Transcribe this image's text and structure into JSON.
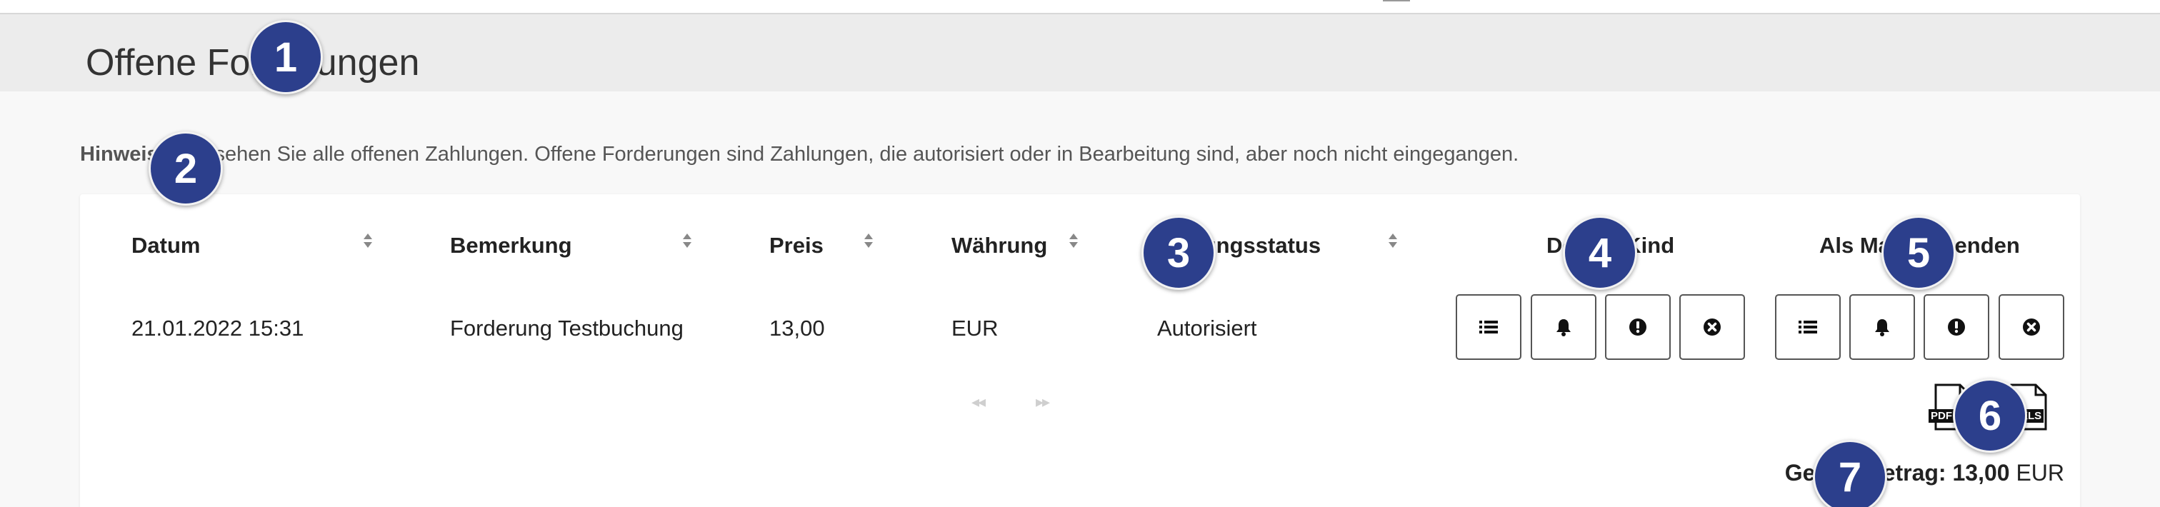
{
  "header": {
    "title": "Offene Forderungen"
  },
  "notice": {
    "label": "Hinweis:",
    "text": "Hier sehen Sie alle offenen Zahlungen. Offene Forderungen sind Zahlungen, die autorisiert oder in Bearbeitung sind, aber noch nicht eingegangen."
  },
  "table": {
    "columns": {
      "datum": "Datum",
      "bemerkung": "Bemerkung",
      "preis": "Preis",
      "waehrung": "Währung",
      "status": "Zahlungsstatus",
      "details": "Details Kind",
      "mail": "Als Mail versenden"
    },
    "rows": [
      {
        "datum": "21.01.2022 15:31",
        "bemerkung": "Forderung Testbuchung",
        "preis": "13,00",
        "waehrung": "EUR",
        "status": "Autorisiert"
      }
    ]
  },
  "pager": {
    "prev": "◂◂",
    "next": "▸▸"
  },
  "exports": {
    "pdf": "PDF",
    "xls": "XLS"
  },
  "total": {
    "label": "Gesamtbetrag:",
    "amount": "13,00",
    "currency": "EUR"
  },
  "markers": [
    "1",
    "2",
    "3",
    "4",
    "5",
    "6",
    "7"
  ],
  "icons": [
    "list-icon",
    "bell-icon",
    "exclamation-icon",
    "close-circle-icon",
    "sort-icon",
    "pdf-file-icon",
    "xls-file-icon"
  ]
}
